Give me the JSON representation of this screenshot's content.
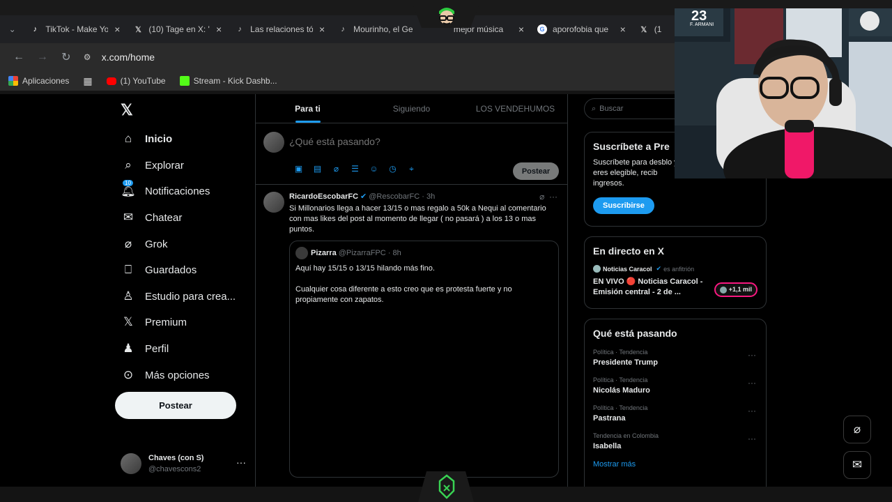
{
  "browser": {
    "tabs": [
      {
        "title": "TikTok - Make Yo",
        "icon": "tiktok-icon"
      },
      {
        "title": "(10) Tage en X: '",
        "icon": "x-icon"
      },
      {
        "title": "Las relaciones tó",
        "icon": "tiktok-icon"
      },
      {
        "title": "Mourinho, el Ge",
        "icon": "tiktok-icon"
      },
      {
        "title": "mejor música",
        "icon": "tiktok-icon"
      },
      {
        "title": "aporofobia que",
        "icon": "google-icon"
      },
      {
        "title": "(1",
        "icon": "x-icon"
      }
    ],
    "url": "x.com/home",
    "bookmarks": [
      {
        "label": "Aplicaciones"
      },
      {
        "label": "(1) YouTube"
      },
      {
        "label": "Stream - Kick Dashb..."
      }
    ]
  },
  "sidebar": {
    "items": [
      {
        "label": "Inicio",
        "icon": "home-icon"
      },
      {
        "label": "Explorar",
        "icon": "search-icon"
      },
      {
        "label": "Notificaciones",
        "icon": "bell-icon",
        "badge": "10"
      },
      {
        "label": "Chatear",
        "icon": "mail-icon"
      },
      {
        "label": "Grok",
        "icon": "grok-icon"
      },
      {
        "label": "Guardados",
        "icon": "bookmark-icon"
      },
      {
        "label": "Estudio para crea...",
        "icon": "studio-icon"
      },
      {
        "label": "Premium",
        "icon": "x-premium-icon"
      },
      {
        "label": "Perfil",
        "icon": "profile-icon"
      },
      {
        "label": "Más opciones",
        "icon": "more-circle-icon"
      }
    ],
    "post_label": "Postear",
    "account": {
      "name": "Chaves (con S)",
      "handle": "@chavescons2"
    }
  },
  "feed": {
    "tabs": [
      "Para ti",
      "Siguiendo",
      "LOS VENDEHUMOS"
    ],
    "compose_placeholder": "¿Qué está pasando?",
    "compose_post_label": "Postear",
    "tweet": {
      "name": "RicardoEscobarFC",
      "handle": "@RescobarFC",
      "time": "3h",
      "text": "Si Millonarios llega a hacer 13/15 o mas regalo a 50k a Nequi al comentario con mas likes del post al momento de llegar ( no pasará ) a los 13 o mas puntos.",
      "quote": {
        "name": "Pizarra",
        "handle": "@PizarraFPC",
        "time": "8h",
        "line1": "Aquí hay 15/15 o 13/15 hilando más fino.",
        "line2": "Cualquier cosa diferente a esto creo que es protesta fuerte y no propiamente con zapatos."
      }
    }
  },
  "right": {
    "search_placeholder": "Buscar",
    "premium": {
      "title": "Suscríbete a Pre",
      "text": "Suscríbete para desblo y, si eres elegible, recib ingresos.",
      "button": "Suscribirse"
    },
    "live": {
      "title": "En directo en X",
      "host": "Noticias Caracol",
      "host_role": "es anfitrión",
      "broadcast": "EN VIVO 🔴 Noticias Caracol - Emisión central - 2 de ...",
      "count": "+1,1 mil"
    },
    "trends": {
      "title": "Qué está pasando",
      "items": [
        {
          "category": "Política · Tendencia",
          "name": "Presidente Trump"
        },
        {
          "category": "Política · Tendencia",
          "name": "Nicolás Maduro"
        },
        {
          "category": "Política · Tendencia",
          "name": "Pastrana"
        },
        {
          "category": "Tendencia en Colombia",
          "name": "Isabella"
        }
      ],
      "show_more": "Mostrar más"
    }
  },
  "overlay": {
    "jersey_number": "23",
    "jersey_name": "F. ARMANI"
  },
  "colors": {
    "accent": "#1d9bf0",
    "live": "#f91880",
    "stream_green": "#39d353"
  }
}
